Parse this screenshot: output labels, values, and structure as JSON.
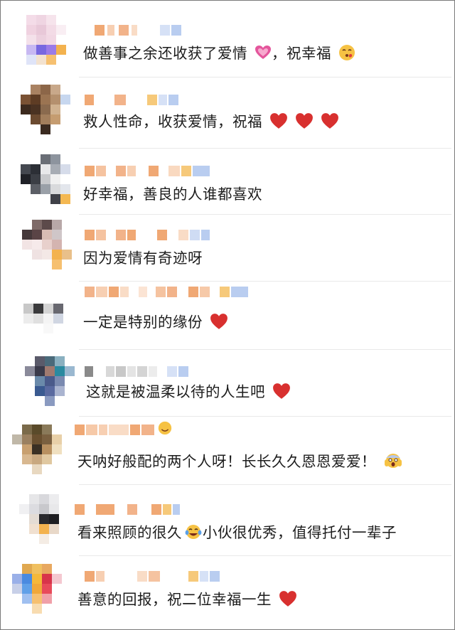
{
  "comments": [
    {
      "text": "做善事之余还收获了爱情",
      "after": "，祝幸福",
      "emojis_mid": [
        "sparkling-heart"
      ],
      "emojis": [
        "kiss-face"
      ]
    },
    {
      "text": "救人性命，收获爱情，祝福",
      "emojis": [
        "red-heart",
        "red-heart",
        "red-heart"
      ]
    },
    {
      "text": "好幸福，善良的人谁都喜欢",
      "emojis": []
    },
    {
      "text": "因为爱情有奇迹呀",
      "emojis": []
    },
    {
      "text": "一定是特别的缘份",
      "emojis": [
        "red-heart"
      ]
    },
    {
      "text": "这就是被温柔以待的人生吧",
      "emojis": [
        "red-heart"
      ]
    },
    {
      "text": "天呐好般配的两个人呀！长长久久恩恩爱爱！",
      "emojis": [
        "screaming-face"
      ]
    },
    {
      "text": "看来照顾的很久",
      "after": "小伙很优秀，值得托付一辈子",
      "emojis_mid": [
        "tears-of-joy-face"
      ],
      "emojis": []
    },
    {
      "text": "善意的回报，祝二位幸福一生",
      "emojis": [
        "red-heart"
      ]
    }
  ],
  "colors": {
    "heart": "#d8302f",
    "emoji_yellow": "#f6c244",
    "blur_orange": "#f0a874",
    "blur_blue": "#b9cdf0"
  }
}
